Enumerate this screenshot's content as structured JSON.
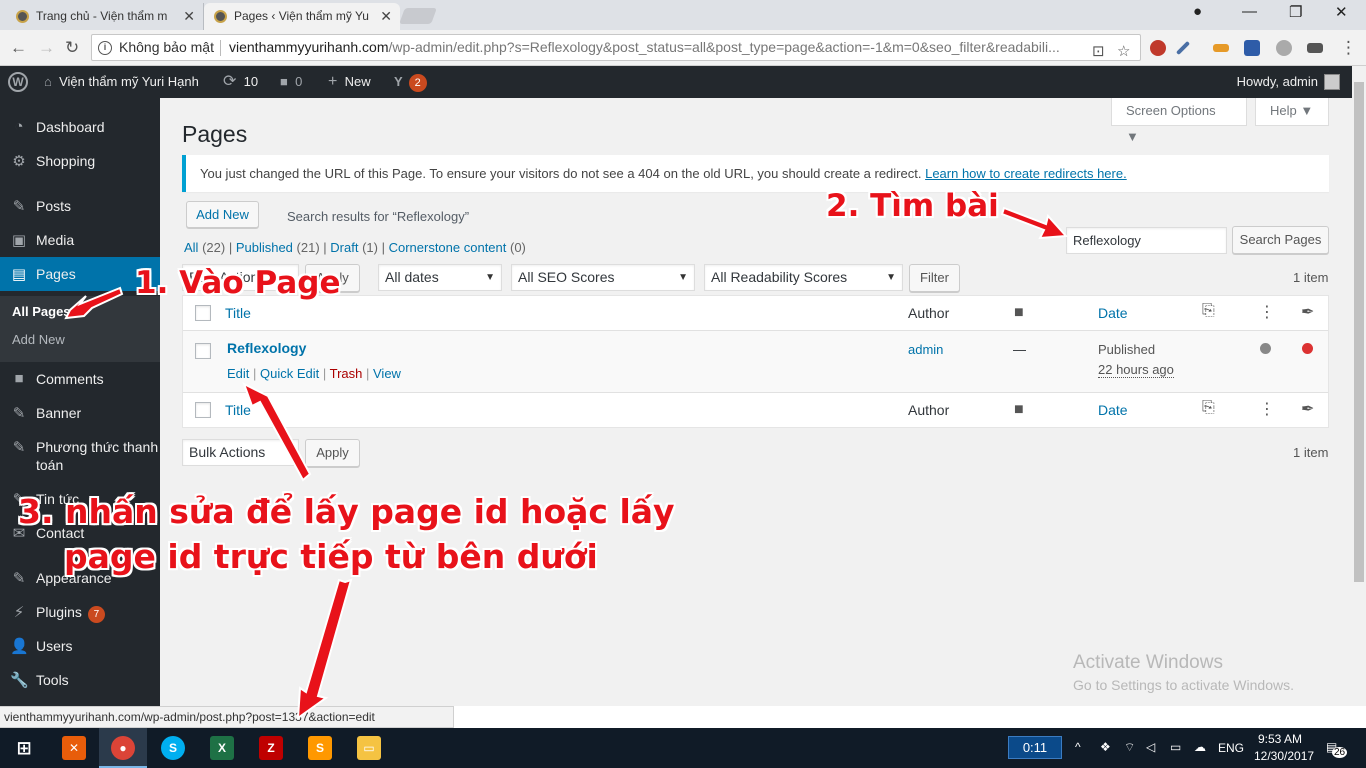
{
  "browser": {
    "tabs": [
      {
        "title": "Trang chủ - Viện thẩm m"
      },
      {
        "title": "Pages ‹ Viện thẩm mỹ Yu"
      }
    ],
    "security_label": "Không bảo mật",
    "url_domain": "vienthammyyurihanh.com",
    "url_path": "/wp-admin/edit.php?s=Reflexology&post_status=all&post_type=page&action=-1&m=0&seo_filter&readabili..."
  },
  "adminbar": {
    "site_name": "Viện thẩm mỹ Yuri Hạnh",
    "updates_count": "10",
    "comments_count": "0",
    "new_label": "New",
    "yoast_count": "2",
    "howdy": "Howdy, admin"
  },
  "sidebar": {
    "items": [
      {
        "label": "Dashboard"
      },
      {
        "label": "Shopping"
      },
      {
        "label": "Posts"
      },
      {
        "label": "Media"
      },
      {
        "label": "Pages"
      },
      {
        "label": "Comments"
      },
      {
        "label": "Banner"
      },
      {
        "label": "Phương thức thanh toán"
      },
      {
        "label": "Tin tức"
      },
      {
        "label": "Contact"
      },
      {
        "label": "Appearance"
      },
      {
        "label": "Plugins"
      },
      {
        "label": "Users"
      },
      {
        "label": "Tools"
      }
    ],
    "submenu": {
      "all_pages": "All Pages",
      "add_new": "Add New"
    },
    "plugins_badge": "7"
  },
  "main": {
    "screen_options": "Screen Options ▼",
    "help": "Help ▼",
    "title": "Pages",
    "notice_text": "You just changed the URL of this Page. To ensure your visitors do not see a 404 on the old URL, you should create a redirect.",
    "notice_link": "Learn how to create redirects here.",
    "add_new": "Add New",
    "search_subtitle": "Search results for “Reflexology”",
    "filters": {
      "all": "All",
      "all_count": "(22)",
      "published": "Published",
      "published_count": "(21)",
      "draft": "Draft",
      "draft_count": "(1)",
      "cornerstone": "Cornerstone content",
      "cornerstone_count": "(0)"
    },
    "search_value": "Reflexology",
    "search_button": "Search Pages",
    "bulk_top": "Bulk Actions",
    "apply": "Apply",
    "dates": "All dates",
    "seo_scores": "All SEO Scores",
    "readability": "All Readability Scores",
    "filter": "Filter",
    "items_count": "1 item",
    "columns": {
      "title": "Title",
      "author": "Author",
      "date": "Date"
    },
    "row": {
      "title": "Reflexology",
      "edit": "Edit",
      "quick_edit": "Quick Edit",
      "trash": "Trash",
      "view": "View",
      "author": "admin",
      "comments": "—",
      "status": "Published",
      "time": "22 hours ago",
      "seo_color": "#888888",
      "readability_color": "#dc3232"
    },
    "bulk_bottom": "Bulk Actions",
    "watermark_title": "Activate Windows",
    "watermark_sub": "Go to Settings to activate Windows."
  },
  "status_link": "vienthammyyurihanh.com/wp-admin/post.php?post=1337&action=edit",
  "taskbar": {
    "timer": "0:11",
    "lang": "ENG",
    "time": "9:53 AM",
    "date": "12/30/2017",
    "notif": "26"
  },
  "annotations": {
    "step1": "1. Vào Page",
    "step2": "2. Tìm bài",
    "step3_line1": "3. nhấn sửa để lấy page id hoặc lấy",
    "step3_line2": "page id trực tiếp từ bên dưới"
  },
  "colors": {
    "wp_dark": "#23282d",
    "wp_blue": "#0073aa",
    "annotation_red": "#e8121a"
  }
}
